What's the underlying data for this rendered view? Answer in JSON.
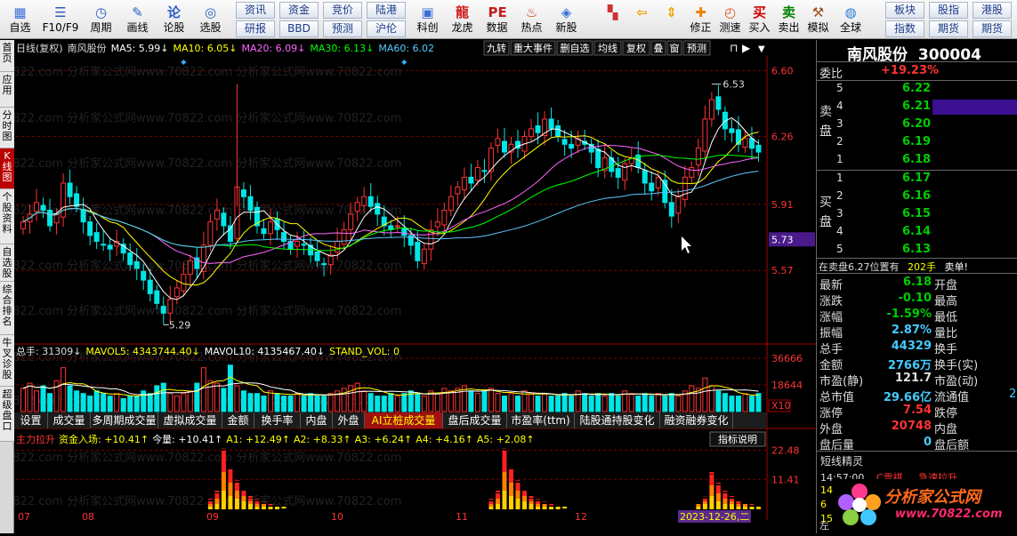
{
  "toolbar": {
    "items": [
      {
        "label": "自选",
        "icon": "grid-icon"
      },
      {
        "label": "F10/F9",
        "icon": "list-icon"
      },
      {
        "label": "周期",
        "icon": "clock-icon"
      },
      {
        "label": "画线",
        "icon": "pencil-icon"
      },
      {
        "label": "论股",
        "icon": "chat-icon"
      },
      {
        "label": "选股",
        "icon": "target-icon"
      }
    ],
    "small_buttons": [
      [
        "资讯",
        "研报"
      ],
      [
        "资金",
        "BBD"
      ],
      [
        "竞价",
        "预测"
      ],
      [
        "陆港",
        "沪伦"
      ]
    ],
    "items2": [
      {
        "label": "科创",
        "icon": "chip-icon"
      },
      {
        "label": "龙虎",
        "icon": "dragon-icon"
      },
      {
        "label": "数据",
        "icon": "pe-icon"
      },
      {
        "label": "热点",
        "icon": "hot-icon"
      },
      {
        "label": "新股",
        "icon": "ipo-icon"
      }
    ],
    "items3": [
      {
        "label": "",
        "icon": "layout-icon"
      },
      {
        "label": "",
        "icon": "back-arrow-icon"
      },
      {
        "label": "",
        "icon": "up-down-icon"
      },
      {
        "label": "修正",
        "icon": "fix-icon"
      },
      {
        "label": "测速",
        "icon": "speed-icon"
      },
      {
        "label": "买入",
        "icon": "buy-icon"
      },
      {
        "label": "卖出",
        "icon": "sell-icon"
      },
      {
        "label": "模拟",
        "icon": "hammer-icon"
      },
      {
        "label": "全球",
        "icon": "globe-icon"
      }
    ],
    "right_buttons": [
      [
        "板块",
        "指数"
      ],
      [
        "股指",
        "期货"
      ],
      [
        "港股",
        "期货"
      ]
    ]
  },
  "left_tabs": [
    "首页",
    "应用",
    "分时图",
    "K线图",
    "个股资料",
    "自选股",
    "综合排名",
    "牛叉诊股",
    "超级盘口"
  ],
  "main_header": {
    "period": "日线(复权)",
    "stock": "南风股份",
    "ma5": "MA5: 5.99↓",
    "ma10": "MA10: 6.05↓",
    "ma20": "MA20: 6.09↓",
    "ma30": "MA30: 6.13↓",
    "ma60": "MA60: 6.02"
  },
  "top_buttons": [
    "九转",
    "重大事件",
    "删自选",
    "均线",
    "复权",
    "叠",
    "窗",
    "预测"
  ],
  "price_axis": [
    "6.60",
    "6.26",
    "5.91",
    "5.73",
    "5.57"
  ],
  "annotations": {
    "high": "6.53",
    "low": "5.29"
  },
  "watermark": "0822.com 分析家公式网www.70822.com 分析家公式网www.70822.com",
  "vol_header": {
    "total": "总手: 31309↓",
    "mavol5": "MAVOL5: 4343744.40↓",
    "mavol10": "MAVOL10: 4135467.40↓",
    "stand": "STAND_VOL: 0"
  },
  "vol_axis": [
    "36666",
    "18644",
    "X10"
  ],
  "bottom_tabs": [
    "设置",
    "成交量",
    "多周期成交量",
    "虚拟成交量",
    "金额",
    "换手率",
    "内盘",
    "外盘",
    "AI立桩成交量",
    "盘后成交量",
    "市盈率(ttm)",
    "陆股通持股变化",
    "融资融券变化"
  ],
  "ind_header": {
    "name": "主力拉升",
    "inflow": "资金入场: +10.41↑",
    "today": "今量: +10.41↑",
    "a1": "A1: +12.49↑",
    "a2": "A2: +8.33↑",
    "a3": "A3: +6.24↑",
    "a4": "A4: +4.16↑",
    "a5": "A5: +2.08↑"
  },
  "ind_button": "指标说明",
  "ind_axis": [
    "22.48",
    "11.41"
  ],
  "months": [
    "07",
    "08",
    "09",
    "10",
    "11",
    "12"
  ],
  "date_badge": "2023-12-26,二",
  "right": {
    "name": "南风股份",
    "code": "300004",
    "weibi_label": "委比",
    "weibi_value": "+19.23%",
    "sell_label": "卖盘",
    "buy_label": "买盘",
    "sells": [
      {
        "n": "5",
        "p": "6.22"
      },
      {
        "n": "4",
        "p": "6.21"
      },
      {
        "n": "3",
        "p": "6.20"
      },
      {
        "n": "2",
        "p": "6.19"
      },
      {
        "n": "1",
        "p": "6.18"
      }
    ],
    "buys": [
      {
        "n": "1",
        "p": "6.17"
      },
      {
        "n": "2",
        "p": "6.16"
      },
      {
        "n": "3",
        "p": "6.15"
      },
      {
        "n": "4",
        "p": "6.14"
      },
      {
        "n": "5",
        "p": "6.13"
      }
    ],
    "notice": "在卖盘6.27位置有",
    "notice_qty": "202手",
    "notice_tag": "卖单!",
    "stats": [
      {
        "l": "最新",
        "v": "6.18",
        "c": "#0c0",
        "l2": "开盘"
      },
      {
        "l": "涨跌",
        "v": "-0.10",
        "c": "#0c0",
        "l2": "最高"
      },
      {
        "l": "涨幅",
        "v": "-1.59%",
        "c": "#0c0",
        "l2": "最低"
      },
      {
        "l": "振幅",
        "v": "2.87%",
        "c": "#4cf",
        "l2": "量比"
      },
      {
        "l": "总手",
        "v": "44329",
        "c": "#4cf",
        "l2": "换手"
      },
      {
        "l": "金额",
        "v": "2766万",
        "c": "#4cf",
        "l2": "换手(实)"
      },
      {
        "l": "市盈(静)",
        "v": "121.7",
        "c": "#ddd",
        "l2": "市盈(动)"
      },
      {
        "l": "总市值",
        "v": "29.66亿",
        "c": "#4cf",
        "l2": "流通值"
      },
      {
        "l": "涨停",
        "v": "7.54",
        "c": "#f33",
        "l2": "跌停"
      },
      {
        "l": "外盘",
        "v": "20748",
        "c": "#f33",
        "l2": "内盘"
      },
      {
        "l": "盘后量",
        "v": "0",
        "c": "#4cf",
        "l2": "盘后额"
      }
    ],
    "circ_partial": "2",
    "elf_title": "短线精灵",
    "elf_row": {
      "time": "14:57:00",
      "name": "C雪祺",
      "event": "急速拉升"
    },
    "elf_nums": [
      "14",
      "6",
      "15"
    ],
    "logo_text": "分析家公式网",
    "logo_url": "www.70822.com",
    "bottom_char": "左"
  },
  "chart_data": {
    "type": "candlestick",
    "series_names": [
      "MA5",
      "MA10",
      "MA20",
      "MA30",
      "MA60"
    ],
    "colors": {
      "ma5": "#ffffff",
      "ma10": "#ffff00",
      "ma20": "#ff66ff",
      "ma30": "#00ff00",
      "ma60": "#5cc8ff",
      "up": "#ff3333",
      "down": "#00e6e6"
    },
    "price_range": [
      5.2,
      6.62
    ],
    "close": [
      5.82,
      5.86,
      5.92,
      5.88,
      5.8,
      5.86,
      6.02,
      5.95,
      5.9,
      5.82,
      5.75,
      5.72,
      5.7,
      5.68,
      5.72,
      5.66,
      5.6,
      5.58,
      5.52,
      5.45,
      5.4,
      5.35,
      5.42,
      5.48,
      5.55,
      5.62,
      5.58,
      5.7,
      5.82,
      5.88,
      5.8,
      5.72,
      6.0,
      5.95,
      5.88,
      5.8,
      5.76,
      5.82,
      5.78,
      5.72,
      5.68,
      5.72,
      5.7,
      5.65,
      5.62,
      5.6,
      5.65,
      5.72,
      5.78,
      5.86,
      5.92,
      5.95,
      5.9,
      5.86,
      5.8,
      5.78,
      5.8,
      5.75,
      5.7,
      5.62,
      5.68,
      5.78,
      5.82,
      5.88,
      5.95,
      6.0,
      6.05,
      6.02,
      6.1,
      6.08,
      6.2,
      6.25,
      6.18,
      6.22,
      6.2,
      6.26,
      6.3,
      6.28,
      6.35,
      6.3,
      6.26,
      6.22,
      6.2,
      6.25,
      6.22,
      6.18,
      6.1,
      6.15,
      6.08,
      6.05,
      6.12,
      6.15,
      6.1,
      6.02,
      5.98,
      6.05,
      5.92,
      5.85,
      5.95,
      6.05,
      6.1,
      6.2,
      6.35,
      6.45,
      6.4,
      6.3,
      6.28,
      6.22,
      6.25,
      6.2,
      6.18
    ],
    "volume": [
      18,
      22,
      16,
      20,
      14,
      24,
      34,
      20,
      16,
      14,
      12,
      16,
      14,
      12,
      14,
      10,
      12,
      12,
      16,
      14,
      20,
      22,
      14,
      12,
      14,
      16,
      22,
      34,
      24,
      22,
      18,
      36,
      20,
      16,
      14,
      14,
      12,
      16,
      14,
      12,
      12,
      14,
      12,
      14,
      12,
      12,
      14,
      16,
      18,
      20,
      22,
      16,
      14,
      12,
      12,
      14,
      12,
      14,
      16,
      14,
      12,
      16,
      14,
      18,
      16,
      18,
      20,
      16,
      14,
      16,
      18,
      14,
      12,
      14,
      12,
      16,
      14,
      12,
      14,
      12,
      12,
      14,
      12,
      16,
      14,
      12,
      14,
      12,
      14,
      12,
      16,
      14,
      12,
      14,
      12,
      14,
      12,
      14,
      12,
      16,
      20,
      18,
      26,
      20,
      16,
      14,
      12,
      12,
      14,
      12,
      14
    ],
    "indicator": [
      0,
      0,
      0,
      0,
      0,
      0,
      0,
      0,
      0,
      0,
      0,
      0,
      0,
      0,
      0,
      0,
      0,
      0,
      0,
      0,
      0,
      0,
      0,
      0,
      0,
      0,
      0,
      0,
      0,
      0,
      0,
      0,
      0,
      0,
      0,
      0,
      0,
      0,
      0,
      0,
      0,
      0,
      0,
      0,
      0,
      0,
      0,
      0,
      0,
      0,
      0,
      0,
      0,
      0,
      0,
      0,
      0,
      0,
      0,
      0,
      0,
      0,
      0,
      0,
      0,
      0,
      0,
      0,
      0,
      0,
      0,
      0,
      0,
      0,
      0,
      0,
      0,
      0,
      0,
      0,
      0,
      0,
      0,
      0,
      0,
      0,
      0,
      0,
      0,
      0,
      0,
      0,
      0,
      0,
      0,
      0,
      0,
      0,
      0,
      0,
      0,
      0,
      0,
      0,
      0,
      0,
      0,
      0,
      0,
      0,
      0
    ],
    "indicator_spikes": [
      {
        "at": 30,
        "v": 22.48
      },
      {
        "at": 72,
        "v": 22.48
      },
      {
        "at": 103,
        "v": 14.0
      }
    ]
  }
}
